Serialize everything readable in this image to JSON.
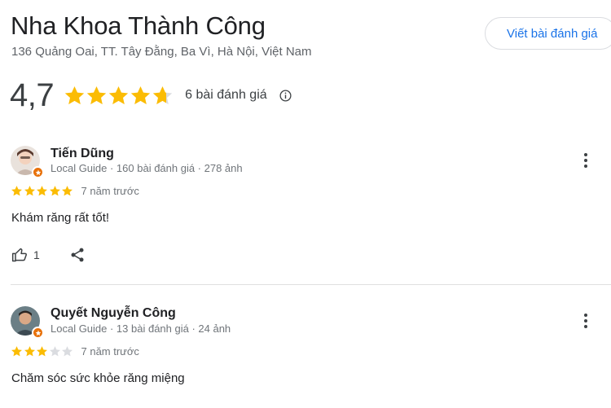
{
  "place": {
    "name": "Nha Khoa Thành Công",
    "address": "136 Quảng Oai, TT. Tây Đằng, Ba Vì, Hà Nội, Việt Nam",
    "write_review_label": "Viết bài đánh giá"
  },
  "summary": {
    "rating": "4,7",
    "rating_value": 4.7,
    "review_count_label": "6 bài đánh giá",
    "info_icon": "info-icon"
  },
  "colors": {
    "star_filled": "#fbbc04",
    "star_empty": "#dadce0",
    "link_blue": "#1a73e8",
    "badge_orange": "#e8710a"
  },
  "reviews": [
    {
      "name": "Tiến Dũng",
      "meta": "Local Guide · 160 bài đánh giá · 278 ảnh",
      "stars": 5,
      "time": "7 năm trước",
      "text": "Khám răng rất tốt!",
      "likes": "1"
    },
    {
      "name": "Quyết Nguyễn Công",
      "meta": "Local Guide · 13 bài đánh giá · 24 ảnh",
      "stars": 3,
      "time": "7 năm trước",
      "text": "Chăm sóc sức khỏe răng miệng"
    }
  ]
}
